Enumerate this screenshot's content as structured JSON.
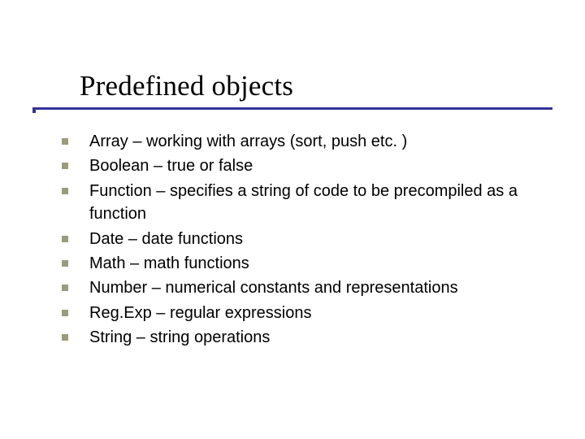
{
  "title": "Predefined objects",
  "bullets": [
    "Array – working with arrays (sort, push etc. )",
    "Boolean – true or false",
    "Function – specifies a string of code to be precompiled as a function",
    "Date – date functions",
    "Math – math functions",
    "Number – numerical constants and representations",
    "Reg.Exp – regular expressions",
    "String – string operations"
  ]
}
